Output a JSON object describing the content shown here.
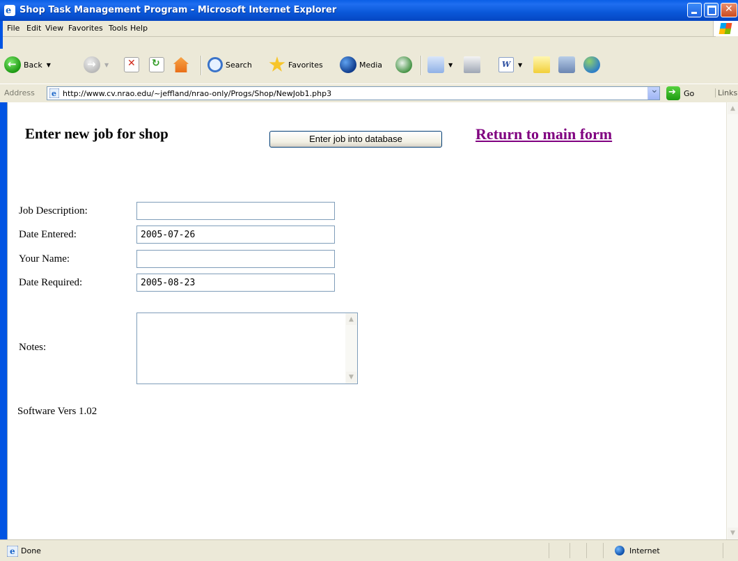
{
  "window": {
    "title": "Shop Task Management Program - Microsoft Internet Explorer"
  },
  "menu": {
    "file": "File",
    "edit": "Edit",
    "view": "View",
    "favorites": "Favorites",
    "tools": "Tools",
    "help": "Help"
  },
  "toolbar": {
    "back": "Back",
    "search": "Search",
    "favorites": "Favorites",
    "media": "Media"
  },
  "address": {
    "label": "Address",
    "url": "http://www.cv.nrao.edu/~jeffland/nrao-only/Progs/Shop/NewJob1.php3",
    "go": "Go",
    "links": "Links"
  },
  "page": {
    "heading": "Enter new job for shop",
    "submit_label": "Enter job into database",
    "return_link": "Return to main form",
    "fields": {
      "job_description_label": "Job Description:",
      "job_description_value": "",
      "date_entered_label": "Date Entered:",
      "date_entered_value": "2005-07-26",
      "your_name_label": "Your Name:",
      "your_name_value": "",
      "date_required_label": "Date Required:",
      "date_required_value": "2005-08-23",
      "notes_label": "Notes:"
    },
    "version": "Software Vers 1.02"
  },
  "status": {
    "text": "Done",
    "zone": "Internet"
  },
  "colors": {
    "titlebar": "#0A57D8",
    "visited_link": "#800080",
    "input_border": "#7F9DB9"
  }
}
